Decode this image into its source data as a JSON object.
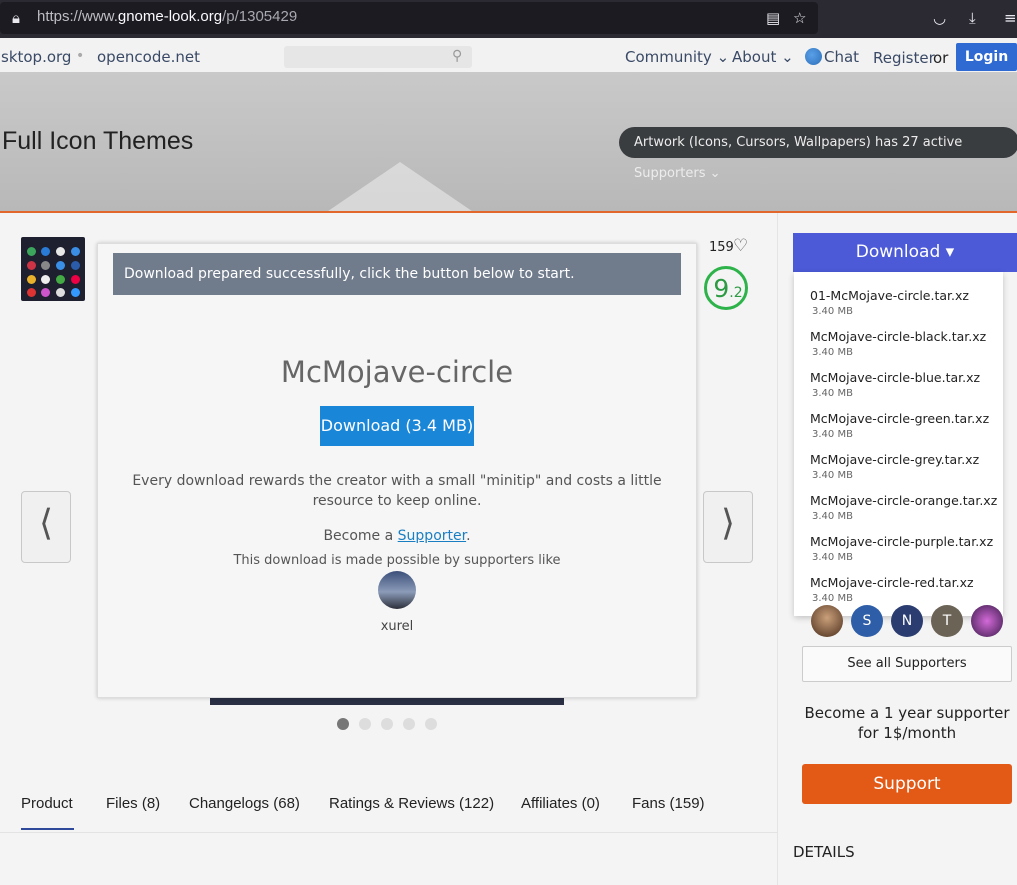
{
  "browser": {
    "url_prefix": "https://www.",
    "url_domain": "gnome-look.org",
    "url_path": "/p/1305429",
    "icons": [
      "lock-icon",
      "reader-icon",
      "star-icon",
      "pocket-icon",
      "download-icon",
      "menu-icon"
    ]
  },
  "nav": {
    "link1": "sktop.org",
    "link2": "opencode.net",
    "community": "Community ⌄",
    "about": "About ⌄",
    "chat": "Chat",
    "register": "Register",
    "or": "or",
    "login": "Login"
  },
  "hero": {
    "title": "Full Icon Themes",
    "supporters": "Artwork (Icons, Cursors, Wallpapers) has 27 active Supporters ⌄"
  },
  "product": {
    "likes": "159",
    "score_main": "9",
    "score_sub": ".2"
  },
  "tabs": [
    "Product",
    "Files (8)",
    "Changelogs (68)",
    "Ratings & Reviews (122)",
    "Affiliates (0)",
    "Fans (159)"
  ],
  "modal": {
    "banner": "Download prepared successfully, click the button below to start.",
    "title": "McMojave-circle",
    "download_label": "Download (3.4 MB)",
    "note": "Every download rewards the creator with a small \"minitip\" and costs a little resource to keep online.",
    "become_prefix": "Become a ",
    "supporter_link": "Supporter",
    "become_suffix": ".",
    "possible": "This download is made possible by supporters like",
    "supporter_name": "xurel"
  },
  "sidebar": {
    "download_label": "Download ▾",
    "files": [
      {
        "name": "01-McMojave-circle.tar.xz",
        "size": "3.40 MB"
      },
      {
        "name": "McMojave-circle-black.tar.xz",
        "size": "3.40 MB"
      },
      {
        "name": "McMojave-circle-blue.tar.xz",
        "size": "3.40 MB"
      },
      {
        "name": "McMojave-circle-green.tar.xz",
        "size": "3.40 MB"
      },
      {
        "name": "McMojave-circle-grey.tar.xz",
        "size": "3.40 MB"
      },
      {
        "name": "McMojave-circle-orange.tar.xz",
        "size": "3.40 MB"
      },
      {
        "name": "McMojave-circle-purple.tar.xz",
        "size": "3.40 MB"
      },
      {
        "name": "McMojave-circle-red.tar.xz",
        "size": "3.40 MB"
      }
    ],
    "supporter_initials": [
      "S",
      "N",
      "T"
    ],
    "see_all": "See all Supporters",
    "year_text": "Become a 1 year supporter for 1$/month",
    "support_label": "Support",
    "details": "DETAILS"
  },
  "colors": {
    "accent": "#4c5ad8",
    "support": "#e25a16",
    "score": "#2db34a",
    "download": "#1a86d8"
  }
}
